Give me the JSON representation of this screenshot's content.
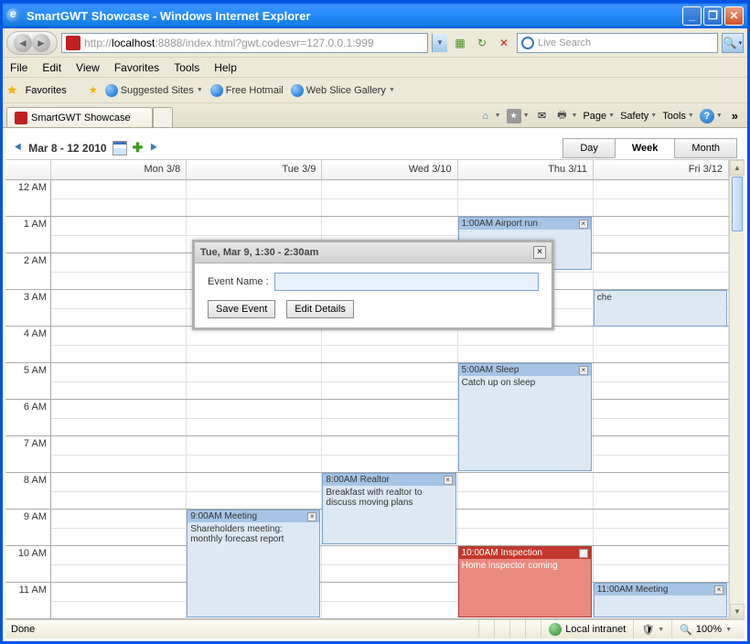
{
  "window": {
    "title": "SmartGWT Showcase - Windows Internet Explorer"
  },
  "address": {
    "prefix": "http://",
    "host": "localhost",
    "rest": ":8888/index.html?gwt.codesvr=127.0.0.1:999"
  },
  "search": {
    "placeholder": "Live Search"
  },
  "menus": [
    "File",
    "Edit",
    "View",
    "Favorites",
    "Tools",
    "Help"
  ],
  "fav_label": "Favorites",
  "fav_links": [
    "Suggested Sites",
    "Free Hotmail",
    "Web Slice Gallery"
  ],
  "tab": {
    "title": "SmartGWT Showcase"
  },
  "cmdbar": {
    "page": "Page",
    "safety": "Safety",
    "tools": "Tools"
  },
  "calendar": {
    "range": "Mar 8 - 12 2010",
    "views": {
      "day": "Day",
      "week": "Week",
      "month": "Month"
    },
    "days": [
      "Mon 3/8",
      "Tue 3/9",
      "Wed 3/10",
      "Thu 3/11",
      "Fri 3/12"
    ],
    "hours": [
      "12 AM",
      "1 AM",
      "2 AM",
      "3 AM",
      "4 AM",
      "5 AM",
      "6 AM",
      "7 AM",
      "8 AM",
      "9 AM",
      "10 AM",
      "11 AM"
    ]
  },
  "events": {
    "airport": {
      "hdr": "1:00AM Airport run",
      "body": ""
    },
    "che": {
      "body": "che"
    },
    "sleep": {
      "hdr": "5:00AM Sleep",
      "body": "Catch up on sleep"
    },
    "realtor": {
      "hdr": "8:00AM Realtor",
      "body": "Breakfast with realtor to discuss moving plans"
    },
    "meeting": {
      "hdr": "9:00AM Meeting",
      "body": "Shareholders meeting: monthly forecast report"
    },
    "inspection": {
      "hdr": "10:00AM Inspection",
      "body": "Home inspector coming"
    },
    "meeting2": {
      "hdr": "11:00AM Meeting",
      "body": ""
    }
  },
  "dialog": {
    "title": "Tue, Mar 9, 1:30 - 2:30am",
    "label": "Event Name :",
    "value": "",
    "save": "Save Event",
    "edit": "Edit Details"
  },
  "status": {
    "done": "Done",
    "zone": "Local intranet",
    "zoom": "100%"
  }
}
